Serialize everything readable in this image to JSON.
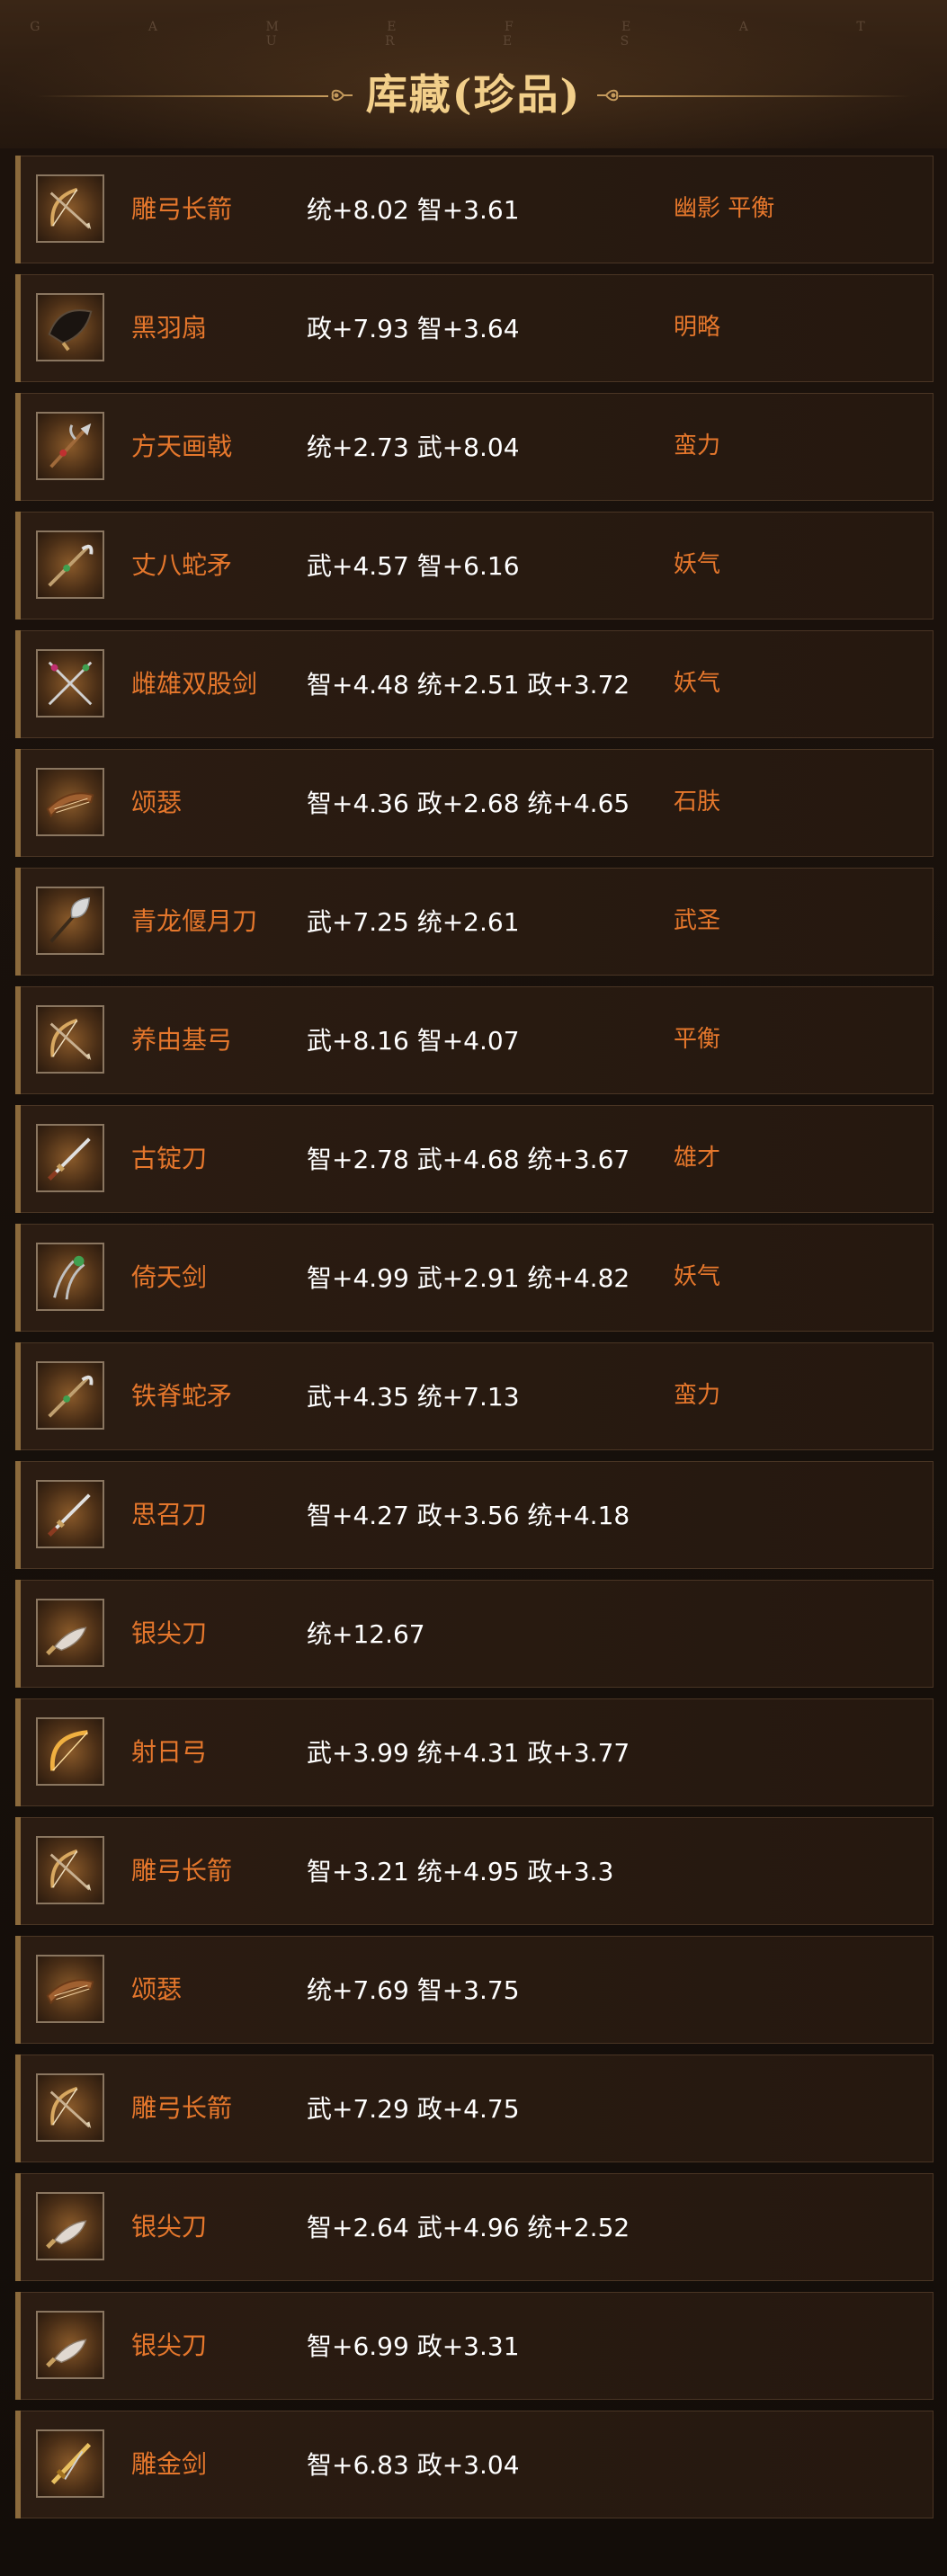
{
  "header": {
    "subtitle": "G A M E   F E A T U R E S",
    "title": "库藏(珍品)"
  },
  "items": [
    {
      "name": "雕弓长箭",
      "stats": "统+8.02 智+3.61",
      "traits": "幽影 平衡",
      "icon": "bow-icon"
    },
    {
      "name": "黑羽扇",
      "stats": "政+7.93 智+3.64",
      "traits": "明略",
      "icon": "feather-fan-icon"
    },
    {
      "name": "方天画戟",
      "stats": "统+2.73 武+8.04",
      "traits": "蛮力",
      "icon": "halberd-icon"
    },
    {
      "name": "丈八蛇矛",
      "stats": "武+4.57 智+6.16",
      "traits": "妖气",
      "icon": "spear-icon"
    },
    {
      "name": "雌雄双股剑",
      "stats": "智+4.48 统+2.51 政+3.72",
      "traits": "妖气",
      "icon": "twin-swords-icon"
    },
    {
      "name": "颂瑟",
      "stats": "智+4.36 政+2.68 统+4.65",
      "traits": "石肤",
      "icon": "zither-icon"
    },
    {
      "name": "青龙偃月刀",
      "stats": "武+7.25 统+2.61",
      "traits": "武圣",
      "icon": "glaive-icon"
    },
    {
      "name": "养由基弓",
      "stats": "武+8.16 智+4.07",
      "traits": "平衡",
      "icon": "bow-icon"
    },
    {
      "name": "古锭刀",
      "stats": "智+2.78 武+4.68 统+3.67",
      "traits": "雄才",
      "icon": "sword-icon"
    },
    {
      "name": "倚天剑",
      "stats": "智+4.99 武+2.91 统+4.82",
      "traits": "妖气",
      "icon": "tongs-icon"
    },
    {
      "name": "铁脊蛇矛",
      "stats": "武+4.35 统+7.13",
      "traits": "蛮力",
      "icon": "spear-icon"
    },
    {
      "name": "思召刀",
      "stats": "智+4.27 政+3.56 统+4.18",
      "traits": "",
      "icon": "sword-icon"
    },
    {
      "name": "银尖刀",
      "stats": "统+12.67",
      "traits": "",
      "icon": "knife-icon"
    },
    {
      "name": "射日弓",
      "stats": "武+3.99 统+4.31 政+3.77",
      "traits": "",
      "icon": "sun-bow-icon"
    },
    {
      "name": "雕弓长箭",
      "stats": "智+3.21 统+4.95 政+3.3",
      "traits": "",
      "icon": "bow-icon"
    },
    {
      "name": "颂瑟",
      "stats": "统+7.69 智+3.75",
      "traits": "",
      "icon": "zither-icon"
    },
    {
      "name": "雕弓长箭",
      "stats": "武+7.29 政+4.75",
      "traits": "",
      "icon": "bow-icon"
    },
    {
      "name": "银尖刀",
      "stats": "智+2.64 武+4.96 统+2.52",
      "traits": "",
      "icon": "knife-icon"
    },
    {
      "name": "银尖刀",
      "stats": "智+6.99 政+3.31",
      "traits": "",
      "icon": "knife-icon"
    },
    {
      "name": "雕金剑",
      "stats": "智+6.83 政+3.04",
      "traits": "",
      "icon": "golden-sword-icon"
    }
  ]
}
